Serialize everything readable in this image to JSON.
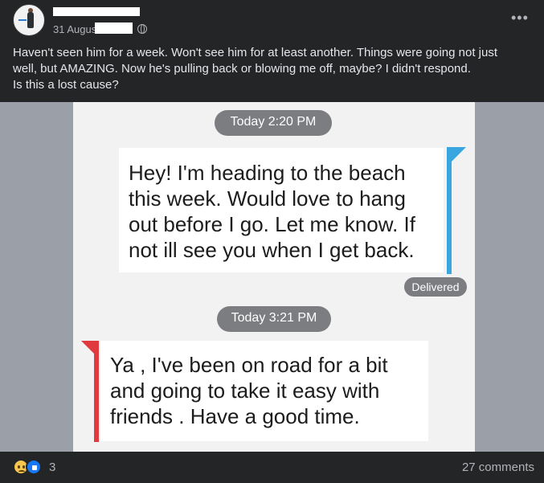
{
  "post": {
    "author_name": "",
    "date": "31 Augus",
    "text_lines": [
      "Haven't seen him for a week. Won't see him for at least another. Things were going not just",
      "well, but AMAZING. Now he's pulling back or blowing me off, maybe? I didn't respond.",
      "Is this a lost cause?"
    ],
    "more_label": "•••"
  },
  "screenshot": {
    "timestamp1": "Today 2:20 PM",
    "outgoing_message": "Hey! I'm heading to the beach this week. Would love to hang out before I go. Let me know. If not ill see you when I get back.",
    "status": "Delivered",
    "timestamp2": "Today 3:21 PM",
    "incoming_message": "Ya , I've been on road for a bit and going to take it easy with friends . Have a good time."
  },
  "footer": {
    "reaction_count": "3",
    "comments_label": "27 comments"
  },
  "colors": {
    "background": "#242526",
    "outgoing_bar": "#3aa6e0",
    "incoming_bar": "#e03a3e",
    "pill": "#7b7d80"
  },
  "icons": [
    "globe-icon",
    "more-options-icon",
    "sad-reaction-icon",
    "like-reaction-icon"
  ]
}
